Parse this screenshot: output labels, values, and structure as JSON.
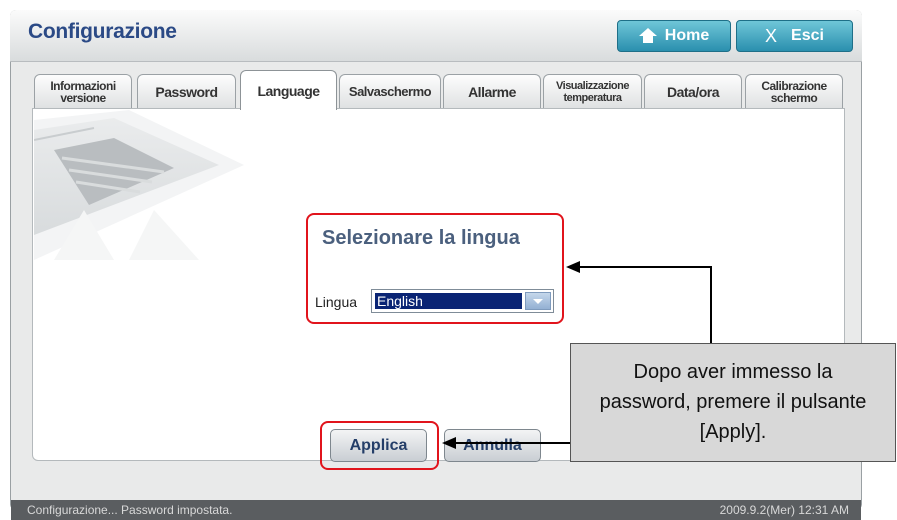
{
  "window": {
    "title": "Configurazione",
    "home_label": "Home",
    "exit_label": "Esci"
  },
  "tabs": [
    {
      "line1": "Informazioni",
      "line2": "versione"
    },
    {
      "label": "Password"
    },
    {
      "label": "Language",
      "active": true
    },
    {
      "label": "Salvaschermo"
    },
    {
      "label": "Allarme"
    },
    {
      "line1": "Visualizzazione",
      "line2": "temperatura"
    },
    {
      "label": "Data/ora"
    },
    {
      "line1": "Calibrazione",
      "line2": "schermo"
    }
  ],
  "language_panel": {
    "heading": "Selezionare la lingua",
    "label": "Lingua",
    "selected": "English"
  },
  "buttons": {
    "apply": "Applica",
    "cancel": "Annulla"
  },
  "callout": {
    "line1": "Dopo aver immesso la",
    "line2": "password, premere il pulsante",
    "line3": "[Apply]."
  },
  "status": {
    "message": "Configurazione... Password impostata.",
    "datetime": "2009.9.2(Mer)  12:31 AM"
  },
  "colors": {
    "title": "#2b4a86",
    "accent_button": "#2a8fae",
    "highlight": "#e1141c",
    "selection": "#0a2474"
  }
}
